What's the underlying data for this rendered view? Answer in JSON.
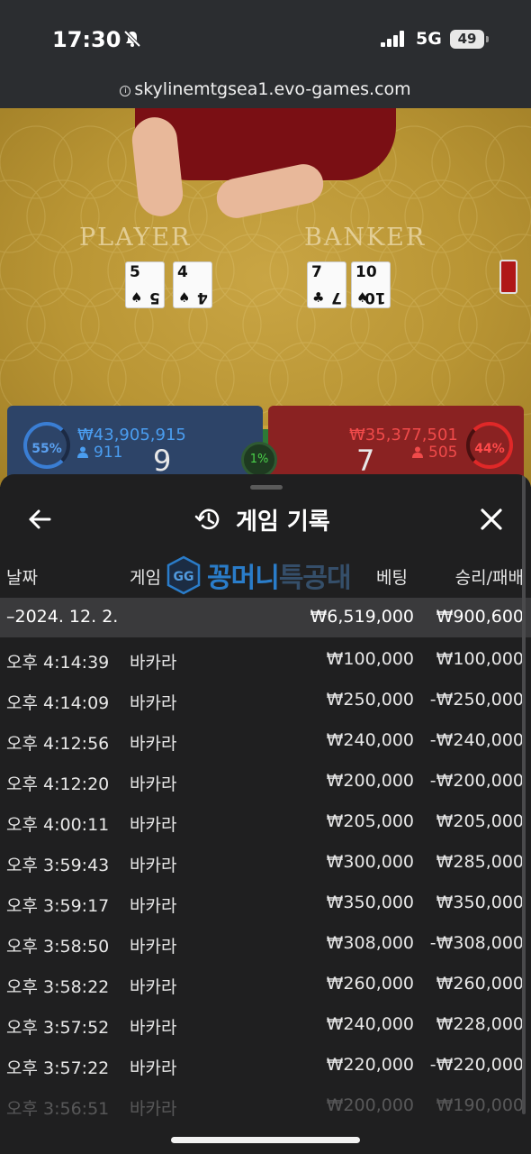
{
  "status_bar": {
    "time": "17:30",
    "network": "5G",
    "battery": "49"
  },
  "browser": {
    "url": "skylinemtgsea1.evo-games.com"
  },
  "game": {
    "player_label": "PLAYER",
    "banker_label": "BANKER",
    "player_cards": [
      {
        "rank": "5",
        "suit": "♠"
      },
      {
        "rank": "4",
        "suit": "♠"
      }
    ],
    "banker_cards": [
      {
        "rank": "7",
        "suit": "♣"
      },
      {
        "rank": "10",
        "suit": "♠"
      }
    ],
    "player": {
      "percent": "55%",
      "amount": "₩43,905,915",
      "count": "911",
      "total": "9"
    },
    "banker": {
      "percent": "44%",
      "amount": "₩35,377,501",
      "count": "505",
      "total": "7"
    },
    "tie": {
      "percent": "1%"
    }
  },
  "sheet": {
    "title": "게임 기록",
    "columns": {
      "date": "날짜",
      "game": "게임",
      "bet": "베팅",
      "win_loss": "승리/패배"
    },
    "watermark": {
      "text": "꽁머니",
      "text_faint": "특공대"
    },
    "date_row": {
      "date": "–2024. 12. 2.",
      "bet": "₩6,519,000",
      "win_loss": "₩900,600"
    },
    "rows": [
      {
        "time": "오후 4:14:39",
        "game": "바카라",
        "bet": "₩100,000",
        "win_loss": "₩100,000"
      },
      {
        "time": "오후 4:14:09",
        "game": "바카라",
        "bet": "₩250,000",
        "win_loss": "-₩250,000"
      },
      {
        "time": "오후 4:12:56",
        "game": "바카라",
        "bet": "₩240,000",
        "win_loss": "-₩240,000"
      },
      {
        "time": "오후 4:12:20",
        "game": "바카라",
        "bet": "₩200,000",
        "win_loss": "-₩200,000"
      },
      {
        "time": "오후 4:00:11",
        "game": "바카라",
        "bet": "₩205,000",
        "win_loss": "₩205,000"
      },
      {
        "time": "오후 3:59:43",
        "game": "바카라",
        "bet": "₩300,000",
        "win_loss": "₩285,000"
      },
      {
        "time": "오후 3:59:17",
        "game": "바카라",
        "bet": "₩350,000",
        "win_loss": "₩350,000"
      },
      {
        "time": "오후 3:58:50",
        "game": "바카라",
        "bet": "₩308,000",
        "win_loss": "-₩308,000"
      },
      {
        "time": "오후 3:58:22",
        "game": "바카라",
        "bet": "₩260,000",
        "win_loss": "₩260,000"
      },
      {
        "time": "오후 3:57:52",
        "game": "바카라",
        "bet": "₩240,000",
        "win_loss": "₩228,000"
      },
      {
        "time": "오후 3:57:22",
        "game": "바카라",
        "bet": "₩220,000",
        "win_loss": "-₩220,000"
      },
      {
        "time": "오후 3:56:51",
        "game": "바카라",
        "bet": "₩200,000",
        "win_loss": "₩190,000"
      }
    ]
  },
  "icons": {
    "status": [
      "bell-slash-icon",
      "signal-icon"
    ],
    "sheet": [
      "back-arrow-icon",
      "history-icon",
      "close-icon"
    ]
  },
  "colors": {
    "player": "#2d4468",
    "banker": "#8a2222",
    "table": "#b99534",
    "sheet": "#1f1f20",
    "date_row": "#3a3a3c"
  }
}
